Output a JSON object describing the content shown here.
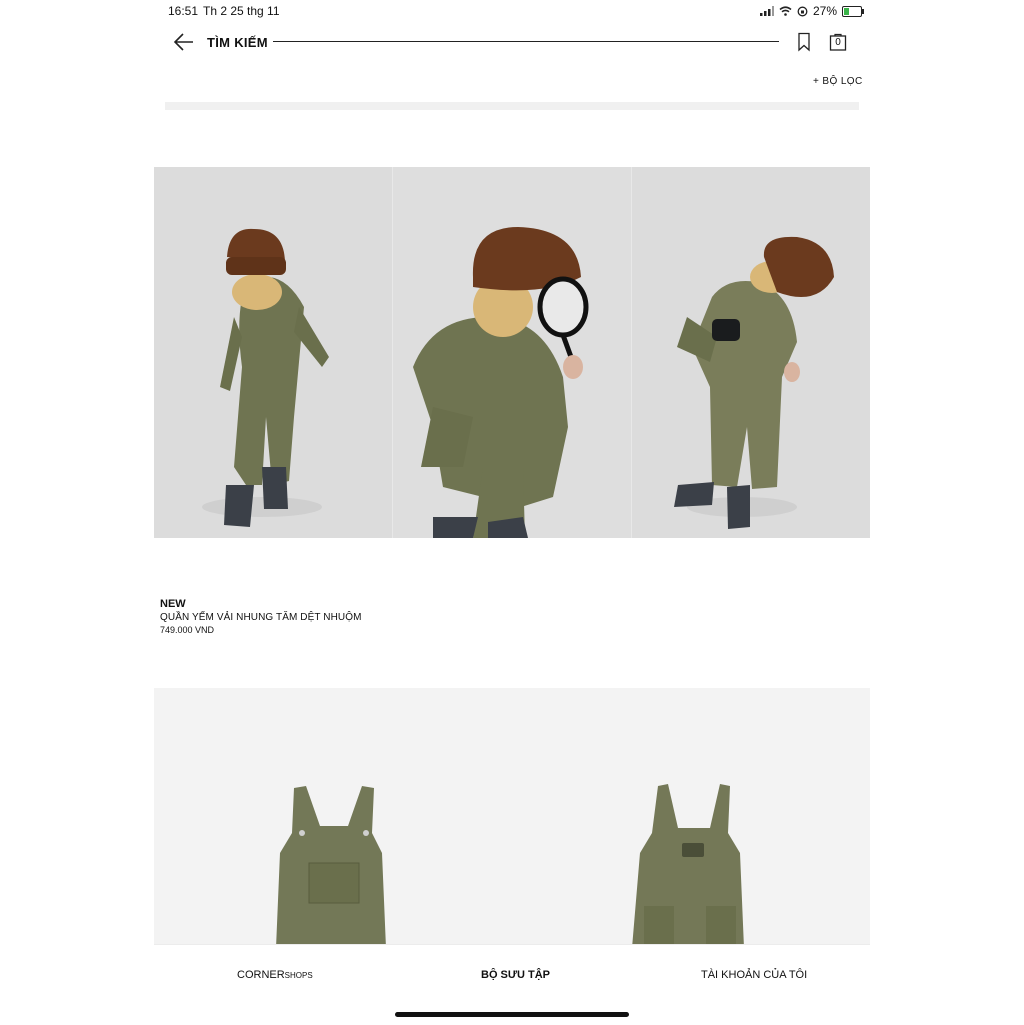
{
  "status_bar": {
    "time": "16:51",
    "date": "Th 2 25 thg 11",
    "battery": "27%"
  },
  "header": {
    "title": "TÌM KIẾM",
    "bag_count": "0",
    "filter_label": "+ BỘ LỌC"
  },
  "product": {
    "badge": "NEW",
    "name": "QUẦN YẾM VẢI NHUNG TĂM DỆT NHUỘM",
    "price": "749.000 VND"
  },
  "bottom_nav": {
    "corner": "CORNER",
    "corner_small": "SHOPS",
    "collection": "BỘ SƯU TẬP",
    "account": "TÀI KHOẢN CỦA TÔI"
  },
  "icons": {
    "back": "arrow-left-icon",
    "bookmark": "bookmark-icon",
    "bag": "shopping-bag-icon"
  },
  "colors": {
    "garment_green": "#6f7451",
    "beanie_brown": "#6b3a1e",
    "photo_bg": "#dcdcdc"
  }
}
